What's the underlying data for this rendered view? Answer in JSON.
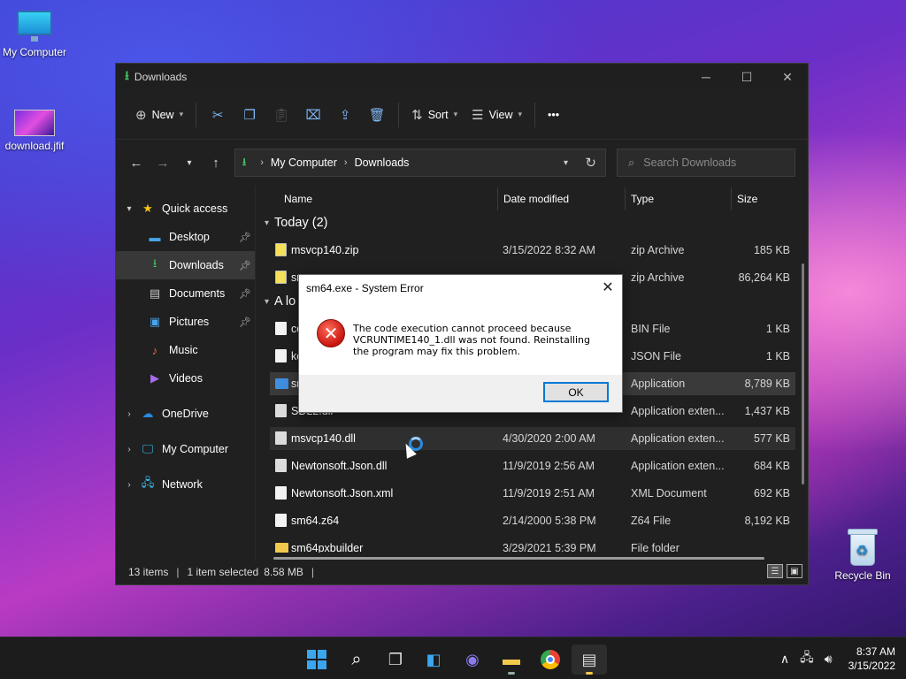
{
  "desktop": {
    "icons": [
      {
        "label": "My Computer"
      },
      {
        "label": "download.jfif"
      },
      {
        "label": "Recycle Bin"
      }
    ]
  },
  "explorer": {
    "title": "Downloads",
    "toolbar": {
      "new_label": "New",
      "sort_label": "Sort",
      "view_label": "View",
      "more_label": "•••"
    },
    "address": {
      "crumbs": [
        "My Computer",
        "Downloads"
      ]
    },
    "search": {
      "placeholder": "Search Downloads"
    },
    "nav": [
      {
        "label": "Quick access"
      },
      {
        "label": "Desktop"
      },
      {
        "label": "Downloads"
      },
      {
        "label": "Documents"
      },
      {
        "label": "Pictures"
      },
      {
        "label": "Music"
      },
      {
        "label": "Videos"
      },
      {
        "label": "OneDrive"
      },
      {
        "label": "My Computer"
      },
      {
        "label": "Network"
      }
    ],
    "columns": {
      "name": "Name",
      "date": "Date modified",
      "type": "Type",
      "size": "Size"
    },
    "groups": [
      {
        "label": "Today (2)"
      },
      {
        "label": "A lo"
      }
    ],
    "files": [
      {
        "name": "msvcp140.zip",
        "date": "3/15/2022 8:32 AM",
        "type": "zip Archive",
        "size": "185 KB"
      },
      {
        "name": "sr",
        "date": "",
        "type": "zip Archive",
        "size": "86,264 KB"
      },
      {
        "name": "co",
        "date": "",
        "type": "BIN File",
        "size": "1 KB"
      },
      {
        "name": "ke",
        "date": "",
        "type": "JSON File",
        "size": "1 KB"
      },
      {
        "name": "sr",
        "date": "",
        "type": "Application",
        "size": "8,789 KB"
      },
      {
        "name": "SDL2.dll",
        "date": "",
        "type": "Application exten...",
        "size": "1,437 KB"
      },
      {
        "name": "msvcp140.dll",
        "date": "4/30/2020 2:00 AM",
        "type": "Application exten...",
        "size": "577 KB"
      },
      {
        "name": "Newtonsoft.Json.dll",
        "date": "11/9/2019 2:56 AM",
        "type": "Application exten...",
        "size": "684 KB"
      },
      {
        "name": "Newtonsoft.Json.xml",
        "date": "11/9/2019 2:51 AM",
        "type": "XML Document",
        "size": "692 KB"
      },
      {
        "name": "sm64.z64",
        "date": "2/14/2000 5:38 PM",
        "type": "Z64 File",
        "size": "8,192 KB"
      },
      {
        "name": "sm64pxbuilder",
        "date": "3/29/2021 5:39 PM",
        "type": "File folder",
        "size": ""
      }
    ],
    "status": {
      "items": "13 items",
      "selected": "1 item selected",
      "selected_size": "8.58 MB"
    }
  },
  "dialog": {
    "title": "sm64.exe - System Error",
    "message": "The code execution cannot proceed because VCRUNTIME140_1.dll was not found. Reinstalling the program may fix this problem.",
    "ok_label": "OK"
  },
  "taskbar": {
    "time": "8:37 AM",
    "date": "3/15/2022"
  }
}
